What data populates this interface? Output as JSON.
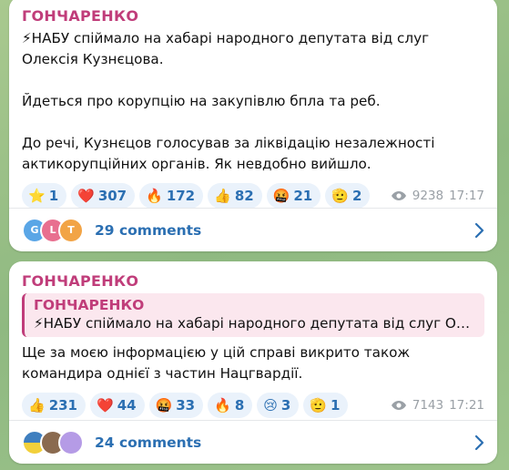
{
  "messages": [
    {
      "author": "ГОНЧАРЕНКО",
      "text": "⚡НАБУ спіймало на хабарі народного депутата від слуг Олексія Кузнєцова.\n\nЙдеться про корупцію на закупівлю бпла та реб.\n\nДо речі, Кузнєцов голосував за ліквідацію незалежності актикорупційних органів. Як невдобно вийшло.",
      "reactions": [
        {
          "emoji": "⭐",
          "count": "1"
        },
        {
          "emoji": "❤️",
          "count": "307"
        },
        {
          "emoji": "🔥",
          "count": "172"
        },
        {
          "emoji": "👍",
          "count": "82"
        },
        {
          "emoji": "🤬",
          "count": "21"
        },
        {
          "emoji": "🫡",
          "count": "2"
        }
      ],
      "views": "9238",
      "time": "17:17",
      "comment_avatars": [
        {
          "letter": "G",
          "color": "#5aa6e6"
        },
        {
          "letter": "L",
          "color": "#e86f8f"
        },
        {
          "letter": "T",
          "color": "#f2a446"
        }
      ],
      "comments_label": "29 comments"
    },
    {
      "author": "ГОНЧАРЕНКО",
      "reply": {
        "author": "ГОНЧАРЕНКО",
        "text": "⚡НАБУ спіймало на хабарі народного депутата від слуг Оле..."
      },
      "text": "Ще за моєю інформацією у цій справі викрито також командира однієї з частин Нацгвардії.",
      "reactions": [
        {
          "emoji": "👍",
          "count": "231"
        },
        {
          "emoji": "❤️",
          "count": "44"
        },
        {
          "emoji": "🤬",
          "count": "33"
        },
        {
          "emoji": "🔥",
          "count": "8"
        },
        {
          "emoji": "😢",
          "count": "3"
        },
        {
          "emoji": "🫡",
          "count": "1"
        }
      ],
      "views": "7143",
      "time": "17:21",
      "comment_avatars": [
        {
          "letter": "",
          "color": "#3f7fbf"
        },
        {
          "letter": "",
          "color": "#8a6a4f"
        },
        {
          "letter": "",
          "color": "#b59be6"
        }
      ],
      "comments_label": "24 comments"
    }
  ],
  "colors": {
    "author": "#c03d7a",
    "link": "#2b6fb2",
    "chip_bg": "#eaf2fb",
    "meta": "#9aa0a6"
  }
}
